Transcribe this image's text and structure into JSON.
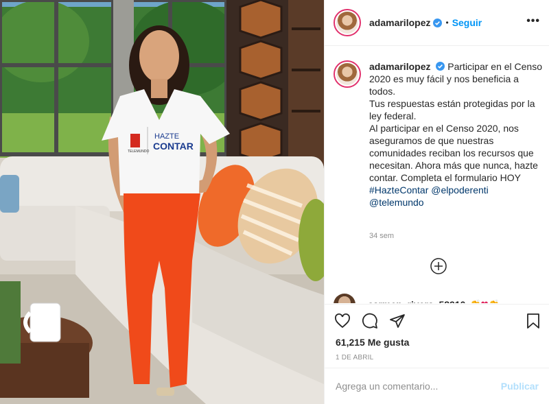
{
  "post": {
    "username": "adamarilopez",
    "follow_label": "Seguir",
    "separator": "•",
    "more_label": "•••"
  },
  "caption": {
    "username": "adamarilopez",
    "lines": [
      "Participar en el Censo 2020 es muy fácil y nos beneficia a todos.",
      "Tus respuestas están protegidas por la ley federal.",
      "Al participar en el Censo 2020, nos aseguramos de que nuestras comunidades reciban los recursos que necesitan. Ahora más que nunca, hazte contar. Completa el formulario HOY"
    ],
    "hashtag": "#HazteContar",
    "mentions": [
      "@elpoderenti",
      "@telemundo"
    ],
    "age": "34 sem"
  },
  "next_comment": {
    "username": "carmen_rivera_58910",
    "emoji": "👏❤👏"
  },
  "engagement": {
    "likes": "61,215 Me gusta",
    "date": "1 DE ABRIL"
  },
  "comment_box": {
    "placeholder": "Agrega un comentario...",
    "publish_label": "Publicar"
  },
  "photo": {
    "shirt_text_line1": "HAZTE",
    "shirt_text_line2": "CONTAR",
    "shirt_brand": "TELEMUNDO"
  },
  "colors": {
    "link": "#0095f6",
    "hashtag": "#00376b",
    "verified": "#3897f0",
    "pants": "#f04a1a",
    "sofa": "#ece9e4"
  }
}
